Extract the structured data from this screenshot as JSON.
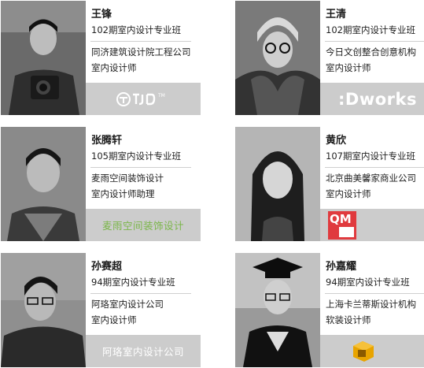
{
  "people": [
    {
      "name": "王锋",
      "class": "102期室内设计专业班",
      "company": "同济建筑设计院工程公司",
      "role": "室内设计师",
      "logo_text": "TJ"
    },
    {
      "name": "王清",
      "class": "102期室内设计专业班",
      "company": "今日文创整合创意机构",
      "role": "室内设计师",
      "logo_text": ":Dworks"
    },
    {
      "name": "张腾轩",
      "class": "105期室内设计专业班",
      "company": "麦雨空间装饰设计",
      "role": "室内设计师助理",
      "logo_text": "麦雨空间装饰设计"
    },
    {
      "name": "黄欣",
      "class": "107期室内设计专业班",
      "company": "北京曲美馨家商业公司",
      "role": "室内设计师",
      "logo_text": "QM"
    },
    {
      "name": "孙赛超",
      "class": "94期室内设计专业班",
      "company": "阿珞室内设计公司",
      "role": "室内设计师",
      "logo_text": "阿珞室内设计公司"
    },
    {
      "name": "孙嘉耀",
      "class": "94期室内设计专业班",
      "company": "上海卡兰蒂斯设计机构",
      "role": "软装设计师",
      "logo_text": ""
    }
  ],
  "colors": {
    "logo_bg": "#cccccc",
    "green": "#7ab648",
    "qm_red": "#e03a3e",
    "gold": "#e8a400"
  }
}
